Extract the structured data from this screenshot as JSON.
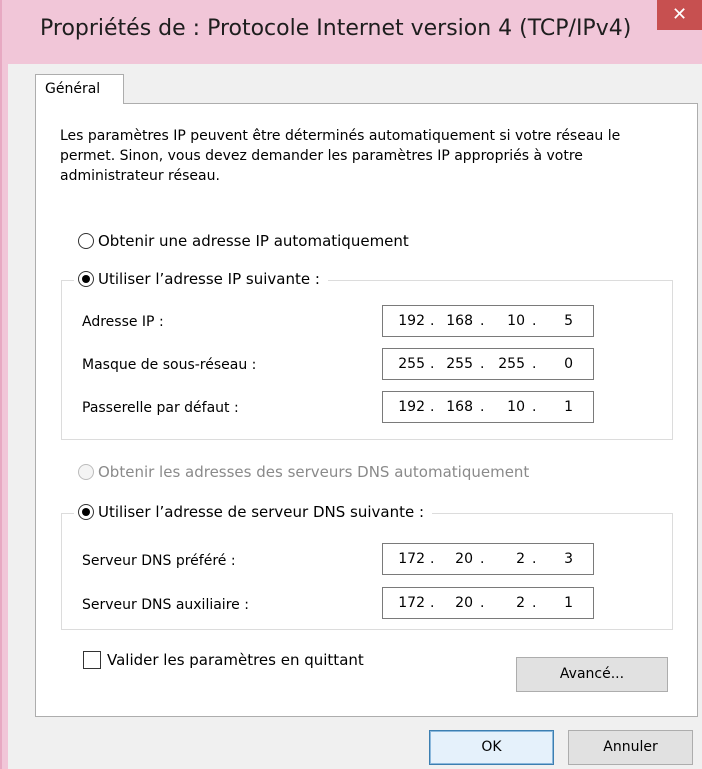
{
  "window": {
    "title": "Propriétés de : Protocole Internet version 4 (TCP/IPv4)",
    "close_glyph": "✕"
  },
  "tabs": [
    {
      "label": "Général"
    }
  ],
  "description": "Les paramètres IP peuvent être déterminés automatiquement si votre réseau le permet. Sinon, vous devez demander les paramètres IP appropriés à votre administrateur réseau.",
  "ip_section": {
    "auto_radio": {
      "label": "Obtenir une adresse IP automatiquement",
      "checked": false
    },
    "manual_radio": {
      "label": "Utiliser l’adresse IP suivante :",
      "checked": true
    },
    "fields": [
      {
        "label": "Adresse IP :",
        "value": [
          "192",
          "168",
          "10",
          "5"
        ]
      },
      {
        "label": "Masque de sous-réseau :",
        "value": [
          "255",
          "255",
          "255",
          "0"
        ]
      },
      {
        "label": "Passerelle par défaut :",
        "value": [
          "192",
          "168",
          "10",
          "1"
        ]
      }
    ]
  },
  "dns_section": {
    "auto_radio": {
      "label": "Obtenir les adresses des serveurs DNS automatiquement",
      "checked": false,
      "disabled": true
    },
    "manual_radio": {
      "label": "Utiliser l’adresse de serveur DNS suivante :",
      "checked": true
    },
    "fields": [
      {
        "label": "Serveur DNS préféré :",
        "value": [
          "172",
          "20",
          "2",
          "3"
        ]
      },
      {
        "label": "Serveur DNS auxiliaire :",
        "value": [
          "172",
          "20",
          "2",
          "1"
        ]
      }
    ]
  },
  "validate_checkbox": {
    "label": "Valider les paramètres en quittant",
    "checked": false
  },
  "buttons": {
    "advanced": "Avancé...",
    "ok": "OK",
    "cancel": "Annuler"
  },
  "colors": {
    "titlebar": "#f1c6d8",
    "close_button": "#c75050",
    "default_button_border": "#3c7fb1"
  }
}
